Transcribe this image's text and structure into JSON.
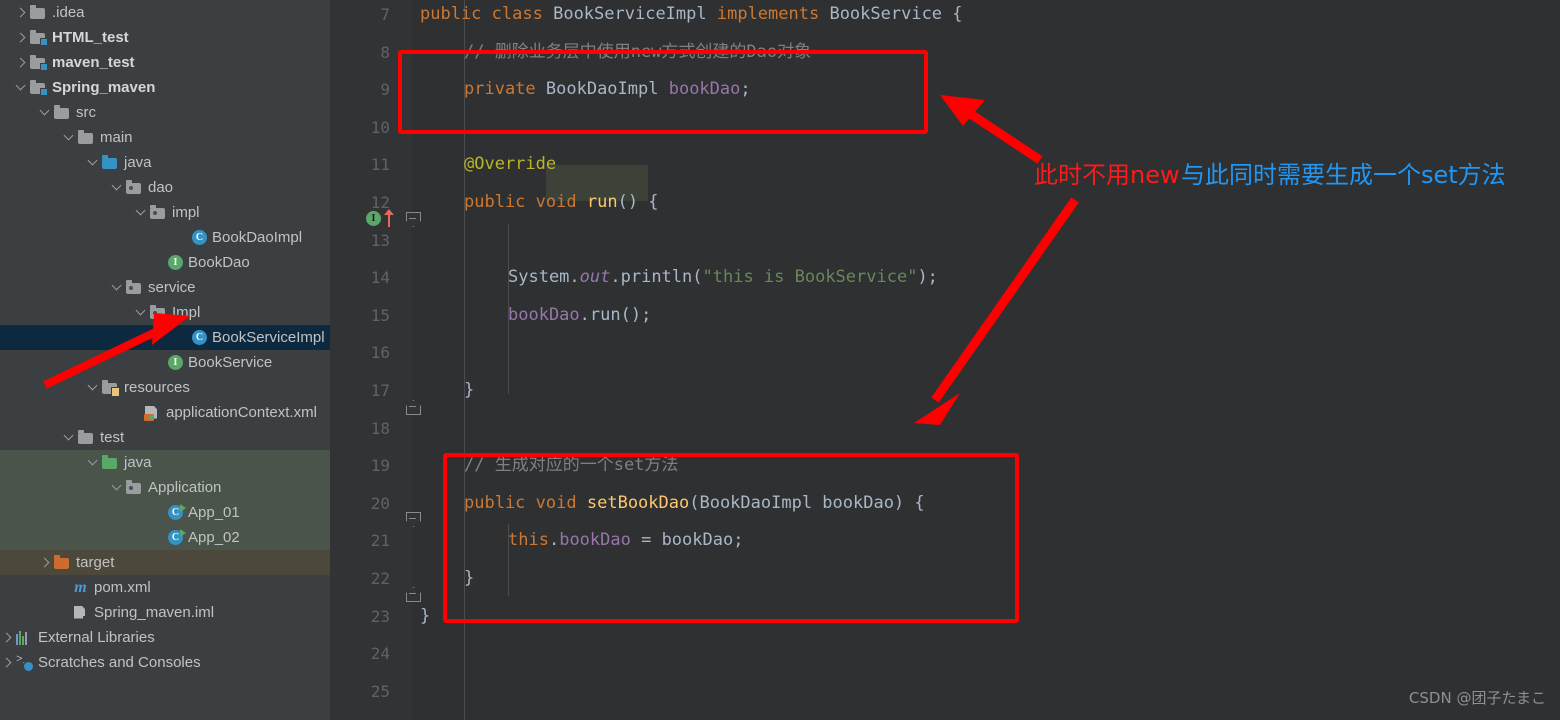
{
  "sidebar": {
    "rows": [
      {
        "label": ".idea",
        "indent": 14,
        "twisty": "right",
        "icon": "folder",
        "bold": false,
        "state": "none"
      },
      {
        "label": "HTML_test",
        "indent": 14,
        "twisty": "right",
        "icon": "folder-mod",
        "bold": true,
        "state": "none"
      },
      {
        "label": "maven_test",
        "indent": 14,
        "twisty": "right",
        "icon": "folder-mod",
        "bold": true,
        "state": "none"
      },
      {
        "label": "Spring_maven",
        "indent": 14,
        "twisty": "down",
        "icon": "folder-mod",
        "bold": true,
        "state": "none"
      },
      {
        "label": "src",
        "indent": 38,
        "twisty": "down",
        "icon": "folder",
        "bold": false,
        "state": "none"
      },
      {
        "label": "main",
        "indent": 62,
        "twisty": "down",
        "icon": "folder",
        "bold": false,
        "state": "none"
      },
      {
        "label": "java",
        "indent": 86,
        "twisty": "down",
        "icon": "folder-src",
        "bold": false,
        "state": "none"
      },
      {
        "label": "dao",
        "indent": 110,
        "twisty": "down",
        "icon": "folder-pkg",
        "bold": false,
        "state": "none"
      },
      {
        "label": "impl",
        "indent": 134,
        "twisty": "down",
        "icon": "folder-pkg",
        "bold": false,
        "state": "none"
      },
      {
        "label": "BookDaoImpl",
        "indent": 176,
        "twisty": "none",
        "icon": "cls",
        "bold": false,
        "state": "none"
      },
      {
        "label": "BookDao",
        "indent": 152,
        "twisty": "none",
        "icon": "iface",
        "bold": false,
        "state": "none"
      },
      {
        "label": "service",
        "indent": 110,
        "twisty": "down",
        "icon": "folder-pkg",
        "bold": false,
        "state": "none"
      },
      {
        "label": "Impl",
        "indent": 134,
        "twisty": "down",
        "icon": "folder-pkg",
        "bold": false,
        "state": "none"
      },
      {
        "label": "BookServiceImpl",
        "indent": 176,
        "twisty": "none",
        "icon": "cls",
        "bold": false,
        "state": "selected"
      },
      {
        "label": "BookService",
        "indent": 152,
        "twisty": "none",
        "icon": "iface",
        "bold": false,
        "state": "none"
      },
      {
        "label": "resources",
        "indent": 86,
        "twisty": "down",
        "icon": "folder-res",
        "bold": false,
        "state": "none"
      },
      {
        "label": "applicationContext.xml",
        "indent": 128,
        "twisty": "none",
        "icon": "xmlspring",
        "bold": false,
        "state": "none"
      },
      {
        "label": "test",
        "indent": 62,
        "twisty": "down",
        "icon": "folder",
        "bold": false,
        "state": "none"
      },
      {
        "label": "java",
        "indent": 86,
        "twisty": "down",
        "icon": "folder-test",
        "bold": false,
        "state": "testsrc"
      },
      {
        "label": "Application",
        "indent": 110,
        "twisty": "down",
        "icon": "folder-pkg",
        "bold": false,
        "state": "testsrc"
      },
      {
        "label": "App_01",
        "indent": 152,
        "twisty": "none",
        "icon": "runnable",
        "bold": false,
        "state": "testsrc"
      },
      {
        "label": "App_02",
        "indent": 152,
        "twisty": "none",
        "icon": "runnable",
        "bold": false,
        "state": "testsrc"
      },
      {
        "label": "target",
        "indent": 38,
        "twisty": "right",
        "icon": "folder-target",
        "bold": false,
        "state": "targetdir"
      },
      {
        "label": "pom.xml",
        "indent": 56,
        "twisty": "none",
        "icon": "maven",
        "bold": false,
        "state": "none"
      },
      {
        "label": "Spring_maven.iml",
        "indent": 56,
        "twisty": "none",
        "icon": "iml",
        "bold": false,
        "state": "none"
      },
      {
        "label": "External Libraries",
        "indent": 0,
        "twisty": "right",
        "icon": "libs",
        "bold": false,
        "state": "none"
      },
      {
        "label": "Scratches and Consoles",
        "indent": 0,
        "twisty": "right",
        "icon": "scratch",
        "bold": false,
        "state": "none"
      }
    ]
  },
  "editor": {
    "line_numbers": [
      "7",
      "8",
      "9",
      "10",
      "11",
      "12",
      "13",
      "14",
      "15",
      "16",
      "17",
      "18",
      "19",
      "20",
      "21",
      "22",
      "23",
      "24",
      "25"
    ],
    "lines": [
      {
        "n": "7",
        "indent": 0,
        "tokens": [
          {
            "t": "public",
            "c": "kw"
          },
          {
            "t": " ",
            "c": "plain"
          },
          {
            "t": "class",
            "c": "kw"
          },
          {
            "t": " BookServiceImpl ",
            "c": "cls2"
          },
          {
            "t": "implements",
            "c": "kw"
          },
          {
            "t": " BookService {",
            "c": "cls2"
          }
        ]
      },
      {
        "n": "8",
        "indent": 44,
        "tokens": [
          {
            "t": "// 删除业务层中使用new方式创建的Dao对象",
            "c": "cmt"
          }
        ]
      },
      {
        "n": "9",
        "indent": 44,
        "tokens": [
          {
            "t": "private",
            "c": "kw"
          },
          {
            "t": " BookDaoImpl ",
            "c": "cls2"
          },
          {
            "t": "bookDao",
            "c": "fld"
          },
          {
            "t": ";",
            "c": "cls2"
          }
        ]
      },
      {
        "n": "10",
        "indent": 0,
        "tokens": []
      },
      {
        "n": "11",
        "indent": 44,
        "tokens": [
          {
            "t": "@Override",
            "c": "ann"
          }
        ]
      },
      {
        "n": "12",
        "indent": 44,
        "tokens": [
          {
            "t": "public",
            "c": "kw"
          },
          {
            "t": " ",
            "c": "plain"
          },
          {
            "t": "void",
            "c": "kw"
          },
          {
            "t": " ",
            "c": "plain"
          },
          {
            "t": "run",
            "c": "mth"
          },
          {
            "t": "() {",
            "c": "cls2"
          }
        ]
      },
      {
        "n": "13",
        "indent": 0,
        "tokens": []
      },
      {
        "n": "14",
        "indent": 88,
        "tokens": [
          {
            "t": "System.",
            "c": "cls2"
          },
          {
            "t": "out",
            "c": "stat"
          },
          {
            "t": ".println(",
            "c": "cls2"
          },
          {
            "t": "\"this is BookService\"",
            "c": "str"
          },
          {
            "t": ");",
            "c": "cls2"
          }
        ]
      },
      {
        "n": "15",
        "indent": 88,
        "tokens": [
          {
            "t": "bookDao",
            "c": "fld"
          },
          {
            "t": ".run();",
            "c": "cls2"
          }
        ]
      },
      {
        "n": "16",
        "indent": 0,
        "tokens": []
      },
      {
        "n": "17",
        "indent": 44,
        "tokens": [
          {
            "t": "}",
            "c": "cls2"
          }
        ]
      },
      {
        "n": "18",
        "indent": 0,
        "tokens": []
      },
      {
        "n": "19",
        "indent": 44,
        "tokens": [
          {
            "t": "// 生成对应的一个set方法",
            "c": "cmt"
          }
        ]
      },
      {
        "n": "20",
        "indent": 44,
        "tokens": [
          {
            "t": "public",
            "c": "kw"
          },
          {
            "t": " ",
            "c": "plain"
          },
          {
            "t": "void",
            "c": "kw"
          },
          {
            "t": " ",
            "c": "plain"
          },
          {
            "t": "setBookDao",
            "c": "mth"
          },
          {
            "t": "(BookDaoImpl bookDao) {",
            "c": "cls2"
          }
        ]
      },
      {
        "n": "21",
        "indent": 88,
        "tokens": [
          {
            "t": "this",
            "c": "kw"
          },
          {
            "t": ".",
            "c": "cls2"
          },
          {
            "t": "bookDao",
            "c": "fld"
          },
          {
            "t": " = bookDao;",
            "c": "cls2"
          }
        ]
      },
      {
        "n": "22",
        "indent": 44,
        "tokens": [
          {
            "t": "}",
            "c": "cls2"
          }
        ]
      },
      {
        "n": "23",
        "indent": 0,
        "tokens": [
          {
            "t": "}",
            "c": "cls2"
          }
        ]
      },
      {
        "n": "24",
        "indent": 0,
        "tokens": []
      },
      {
        "n": "25",
        "indent": 0,
        "tokens": []
      }
    ],
    "gutter_markers": {
      "implement_marker_line": "12",
      "implement_marker_glyph": "I",
      "override_arrow": "up-arrow"
    }
  },
  "annotations": {
    "note_red": "此时不用new",
    "note_blue": "与此同时需要生成一个set方法",
    "colors": {
      "red": "#ff1a1a",
      "blue": "#2196f3",
      "box": "#ff0000"
    }
  },
  "watermark": {
    "text": "CSDN @团子たまこ"
  }
}
